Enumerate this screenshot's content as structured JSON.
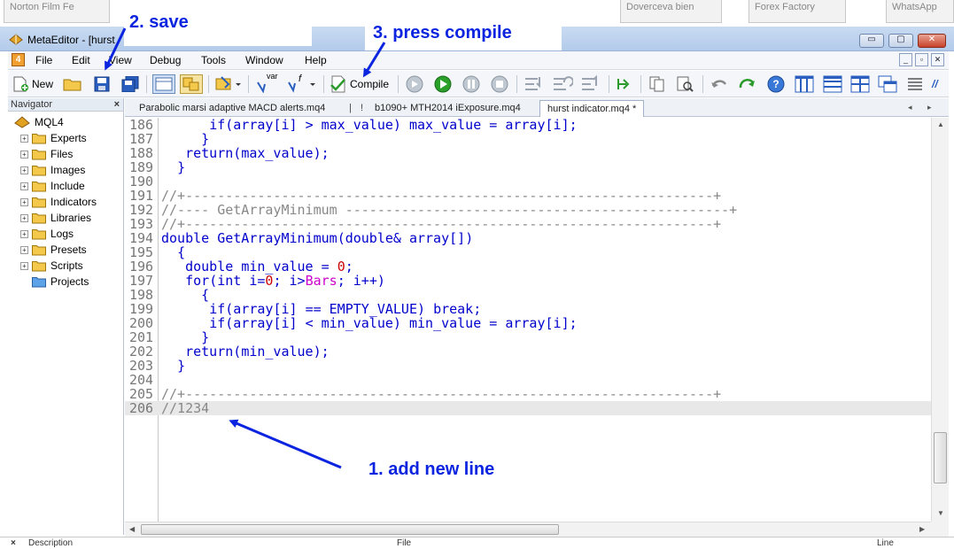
{
  "window": {
    "title": "MetaEditor - [hurst",
    "min": "▭",
    "max": "▢",
    "close": "✕"
  },
  "background_tabs": [
    "Norton Film Fe",
    "Doverceva bien",
    "Forex Factory",
    "WhatsApp"
  ],
  "menu": [
    "File",
    "Edit",
    "View",
    "Debug",
    "Tools",
    "Window",
    "Help"
  ],
  "toolbar": {
    "new_label": "New",
    "compile_label": "Compile",
    "var_label": "var",
    "f_label": "f"
  },
  "navigator": {
    "title": "Navigator",
    "close": "×",
    "root": "MQL4",
    "items": [
      "Experts",
      "Files",
      "Images",
      "Include",
      "Indicators",
      "Libraries",
      "Logs",
      "Presets",
      "Scripts",
      "Projects"
    ]
  },
  "tabs": [
    "Parabolic marsi adaptive MACD alerts.mq4",
    "b1090+ MTH2014 iExposure.mq4",
    "hurst indicator.mq4 *"
  ],
  "editor": {
    "lines": [
      {
        "n": "186",
        "code": "      if(array[i] > max_value) max_value = array[i];"
      },
      {
        "n": "187",
        "code": "     }"
      },
      {
        "n": "188",
        "code": "   return(max_value);"
      },
      {
        "n": "189",
        "code": "  }"
      },
      {
        "n": "190",
        "code": ""
      },
      {
        "n": "191",
        "code": "//+------------------------------------------------------------------+"
      },
      {
        "n": "192",
        "code": "//---- GetArrayMinimum ------------------------------------------------+"
      },
      {
        "n": "193",
        "code": "//+------------------------------------------------------------------+"
      },
      {
        "n": "194",
        "code": "double GetArrayMinimum(double& array[])"
      },
      {
        "n": "195",
        "code": "  {"
      },
      {
        "n": "196",
        "code": "   double min_value = 0;"
      },
      {
        "n": "197",
        "code": "   for(int i=0; i>Bars; i++)"
      },
      {
        "n": "198",
        "code": "     {"
      },
      {
        "n": "199",
        "code": "      if(array[i] == EMPTY_VALUE) break;"
      },
      {
        "n": "200",
        "code": "      if(array[i] < min_value) min_value = array[i];"
      },
      {
        "n": "201",
        "code": "     }"
      },
      {
        "n": "202",
        "code": "   return(min_value);"
      },
      {
        "n": "203",
        "code": "  }"
      },
      {
        "n": "204",
        "code": ""
      },
      {
        "n": "205",
        "code": "//+------------------------------------------------------------------+"
      },
      {
        "n": "206",
        "code": "//1234"
      }
    ]
  },
  "annotations": {
    "save": "2. save",
    "compile": "3. press compile",
    "add_line": "1. add new line"
  },
  "status": {
    "left": "Description",
    "mid": "File",
    "right": "Line"
  },
  "colors": {
    "annotation": "#0b24e0",
    "keyword": "#0000cc",
    "comment": "#888888",
    "number": "#cc0000"
  }
}
